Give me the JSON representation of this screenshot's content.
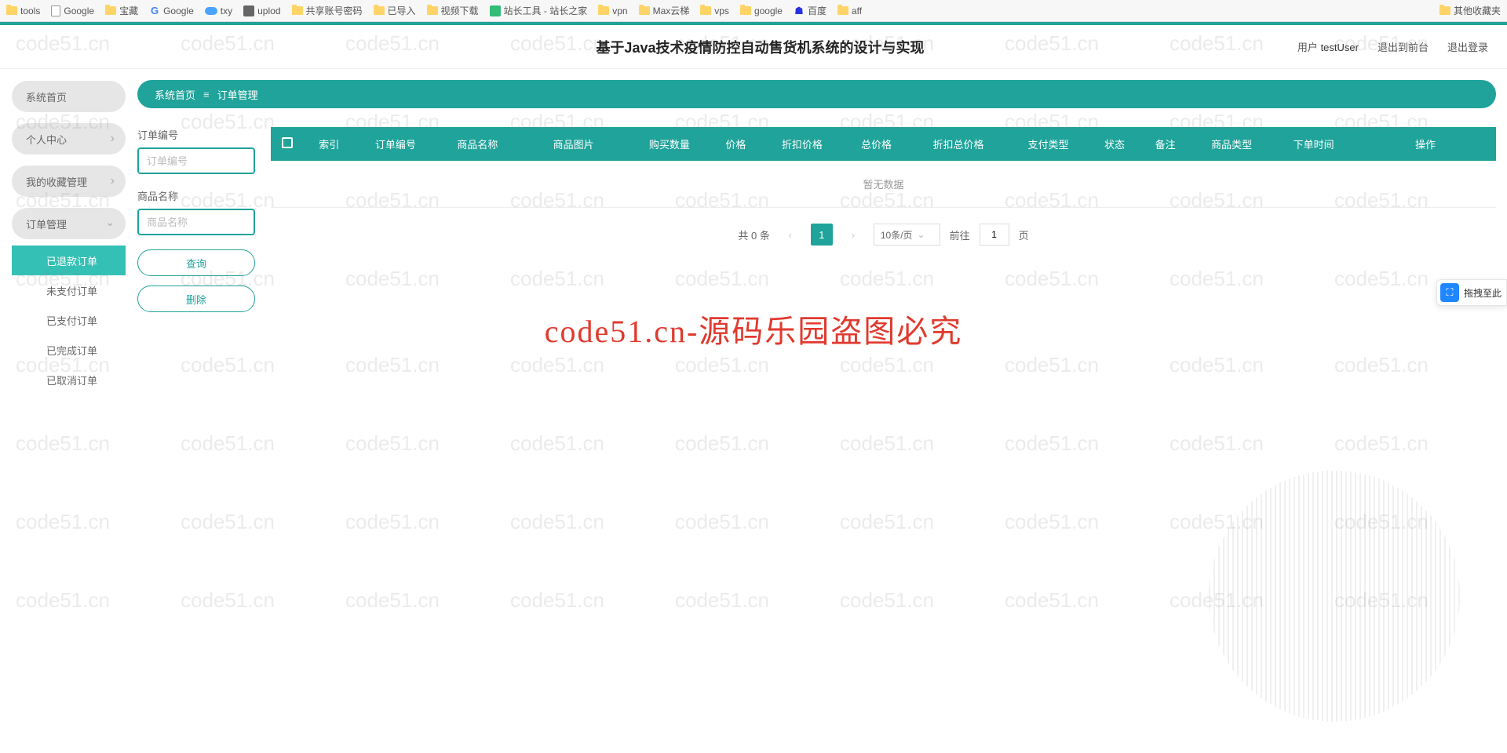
{
  "bookmarks": {
    "left": [
      "tools",
      "Google",
      "宝藏",
      "Google",
      "txy",
      "uplod",
      "共享账号密码",
      "已导入",
      "视频下载",
      "站长工具 - 站长之家",
      "vpn",
      "Max云梯",
      "vps",
      "google",
      "百度",
      "aff"
    ],
    "right": "其他收藏夹"
  },
  "header": {
    "title": "基于Java技术疫情防控自动售货机系统的设计与实现",
    "user_prefix": "用户",
    "username": "testUser",
    "to_front": "退出到前台",
    "logout": "退出登录"
  },
  "sidebar": {
    "home": "系统首页",
    "profile": "个人中心",
    "favorites": "我的收藏管理",
    "orders": "订单管理",
    "sub": {
      "refunded": "已退款订单",
      "unpaid": "未支付订单",
      "paid": "已支付订单",
      "completed": "已完成订单",
      "cancelled": "已取消订单"
    }
  },
  "breadcrumb": {
    "root": "系统首页",
    "current": "订单管理"
  },
  "filters": {
    "order_no_label": "订单编号",
    "order_no_placeholder": "订单编号",
    "product_name_label": "商品名称",
    "product_name_placeholder": "商品名称",
    "search_btn": "查询",
    "delete_btn": "删除"
  },
  "table": {
    "headers": [
      "索引",
      "订单编号",
      "商品名称",
      "商品图片",
      "购买数量",
      "价格",
      "折扣价格",
      "总价格",
      "折扣总价格",
      "支付类型",
      "状态",
      "备注",
      "商品类型",
      "下单时间",
      "操作"
    ],
    "empty": "暂无数据"
  },
  "pagination": {
    "total": "共 0 条",
    "current": "1",
    "page_size": "10条/页",
    "goto_prefix": "前往",
    "goto_value": "1",
    "goto_suffix": "页"
  },
  "watermark": {
    "small": "code51.cn",
    "big": "code51.cn-源码乐园盗图必究"
  },
  "widget": {
    "label": "拖拽至此"
  }
}
